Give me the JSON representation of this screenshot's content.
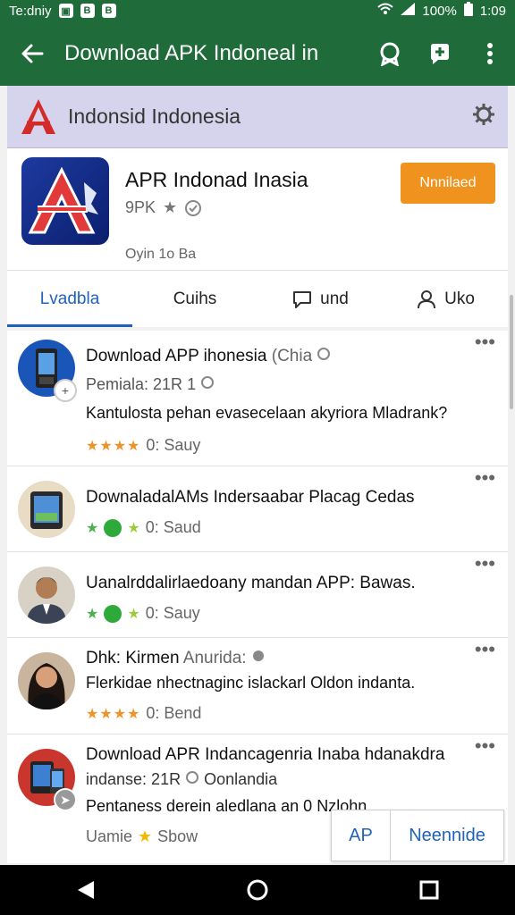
{
  "status_bar": {
    "left_text": "Te:dniy",
    "icons": [
      "gallery-icon",
      "b-icon",
      "b-icon"
    ],
    "right_icons": [
      "wifi-icon",
      "signal-icon"
    ],
    "battery": "100%",
    "time": "1:09"
  },
  "app_bar": {
    "title": "Download APK Indoneal in",
    "actions": [
      "badge-icon",
      "add-icon",
      "more-vert-icon"
    ]
  },
  "subheader": {
    "title": "Indonsid Indonesia"
  },
  "app_card": {
    "name": "APR Indonad Inasia",
    "meta": "9PK",
    "sub": "Oyin 1o Ba",
    "install_label": "Nnnilaed"
  },
  "tabs": [
    {
      "label": "Lvadbla",
      "icon": "",
      "active": true
    },
    {
      "label": "Cuihs",
      "icon": "",
      "active": false
    },
    {
      "label": "und",
      "icon": "chat-icon",
      "active": false
    },
    {
      "label": "Uko",
      "icon": "person-icon",
      "active": false
    }
  ],
  "reviews": [
    {
      "title": "Download APP ihonesia",
      "title_suffix": "(Chia",
      "meta": "Pemiala: 21R",
      "meta_suffix": "1",
      "desc": "Kantulosta pehan evasecelaan akyriora Mladrank?",
      "rating_text": "0:  Sauy",
      "star_style": "orange4",
      "avatar": "phone"
    },
    {
      "title": "DownaladalAMs Indersaabar Placag Cedas",
      "rating_text": "0:  Saud",
      "star_style": "green",
      "avatar": "tablet"
    },
    {
      "title": "Uanalrddalirlaedoany mandan APP: Bawas.",
      "rating_text": "0:  Sauy",
      "star_style": "green",
      "avatar": "man"
    },
    {
      "title": "Dhk: Kirmen",
      "title_suffix": "Anurida:",
      "desc": "Flerkidae nhectnaginc islackarl Oldon indanta.",
      "rating_text": "0:  Bend",
      "star_style": "orange4",
      "avatar": "woman"
    },
    {
      "title": "Download APR Indancagenria Inaba hdanakdra",
      "meta": "indanse:  21R",
      "meta_suffix": "Oonlandia",
      "desc": "Pentaness derein aledlana an 0 Nzlohn",
      "rating_text": "Uamie",
      "rating_suffix": "Sbow",
      "star_style": "single",
      "avatar": "devices"
    }
  ],
  "floating": {
    "chip_a": "AP",
    "chip_b": "Neennide"
  },
  "colors": {
    "primary": "#1f6b3a",
    "accent": "#f0921e",
    "tab_active": "#1f63b8",
    "subheader": "#d6d4ec"
  }
}
